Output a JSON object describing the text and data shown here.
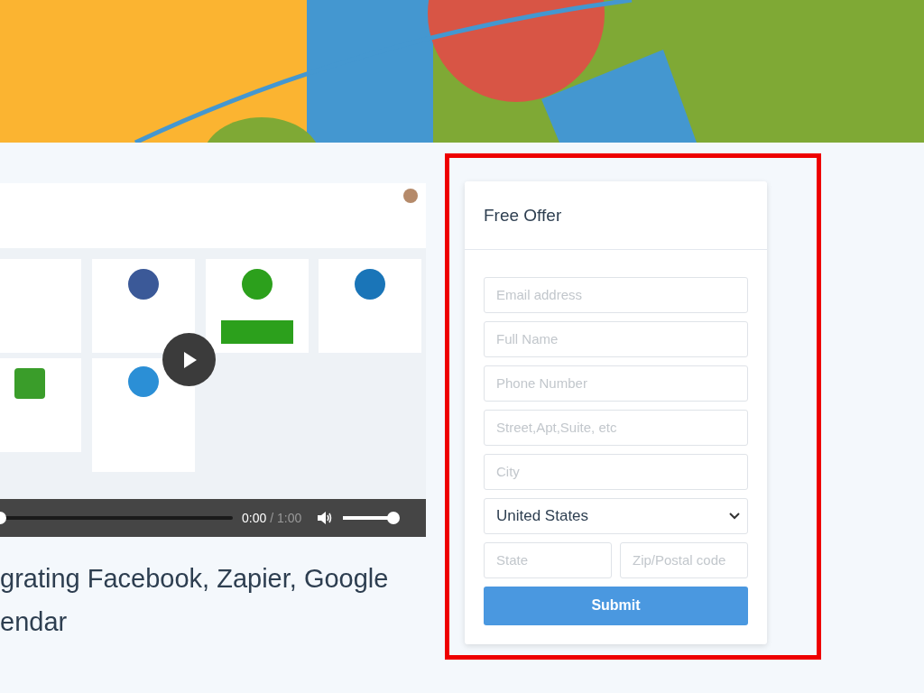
{
  "video": {
    "progress": {
      "level": 0
    },
    "current_time": "0:00",
    "duration": "/ 1:00",
    "volume": {
      "level": 1
    }
  },
  "heading_lines": [
    "grating Facebook, Zapier, Google",
    "endar"
  ],
  "form": {
    "title": "Free Offer",
    "fields": [
      {
        "placeholder": "Email address"
      },
      {
        "placeholder": "Full Name"
      },
      {
        "placeholder": "Phone Number"
      },
      {
        "placeholder": "Street,Apt,Suite, etc"
      },
      {
        "placeholder": "City"
      }
    ],
    "country": {
      "value": "United States"
    },
    "half_fields": [
      {
        "placeholder": "State"
      },
      {
        "placeholder": "Zip/Postal code"
      }
    ],
    "submit": "Submit"
  }
}
